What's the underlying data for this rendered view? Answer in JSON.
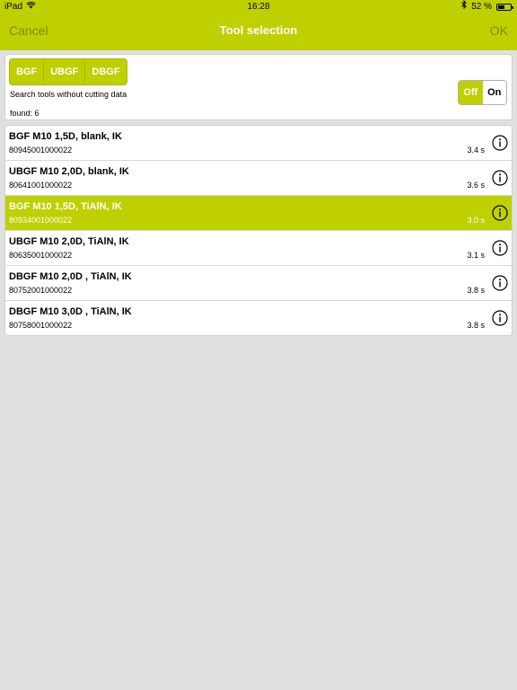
{
  "status_bar": {
    "carrier": "iPad",
    "time": "16:28",
    "battery_text": "52 %",
    "battery_level": 0.52,
    "icons": [
      "wifi-icon",
      "bluetooth-icon",
      "battery-icon"
    ]
  },
  "nav": {
    "cancel_label": "Cancel",
    "title": "Tool selection",
    "ok_label": "OK"
  },
  "filter": {
    "segments": [
      "BGF",
      "UBGF",
      "DBGF"
    ],
    "search_label": "Search tools without cutting data",
    "toggle_off": "Off",
    "toggle_on": "On",
    "toggle_selected": "Off",
    "found": "found: 6"
  },
  "tools": [
    {
      "name": "BGF M10 1,5D, blank, IK",
      "code": "80945001000022",
      "time": "3.4 s",
      "selected": false
    },
    {
      "name": "UBGF M10 2,0D, blank, IK",
      "code": "80641001000022",
      "time": "3.6 s",
      "selected": false
    },
    {
      "name": "BGF M10 1,5D, TiAlN, IK",
      "code": "80934001000022",
      "time": "3.0 s",
      "selected": true
    },
    {
      "name": "UBGF M10 2,0D, TiAlN, IK",
      "code": "80635001000022",
      "time": "3.1 s",
      "selected": false
    },
    {
      "name": "DBGF M10 2,0D , TiAlN, IK",
      "code": "80752001000022",
      "time": "3.8 s",
      "selected": false
    },
    {
      "name": "DBGF M10 3,0D , TiAlN, IK",
      "code": "80758001000022",
      "time": "3.8 s",
      "selected": false
    }
  ],
  "colors": {
    "accent": "#bfd001",
    "nav_button_text": "#7b8a00",
    "background": "#e0e0e0"
  }
}
